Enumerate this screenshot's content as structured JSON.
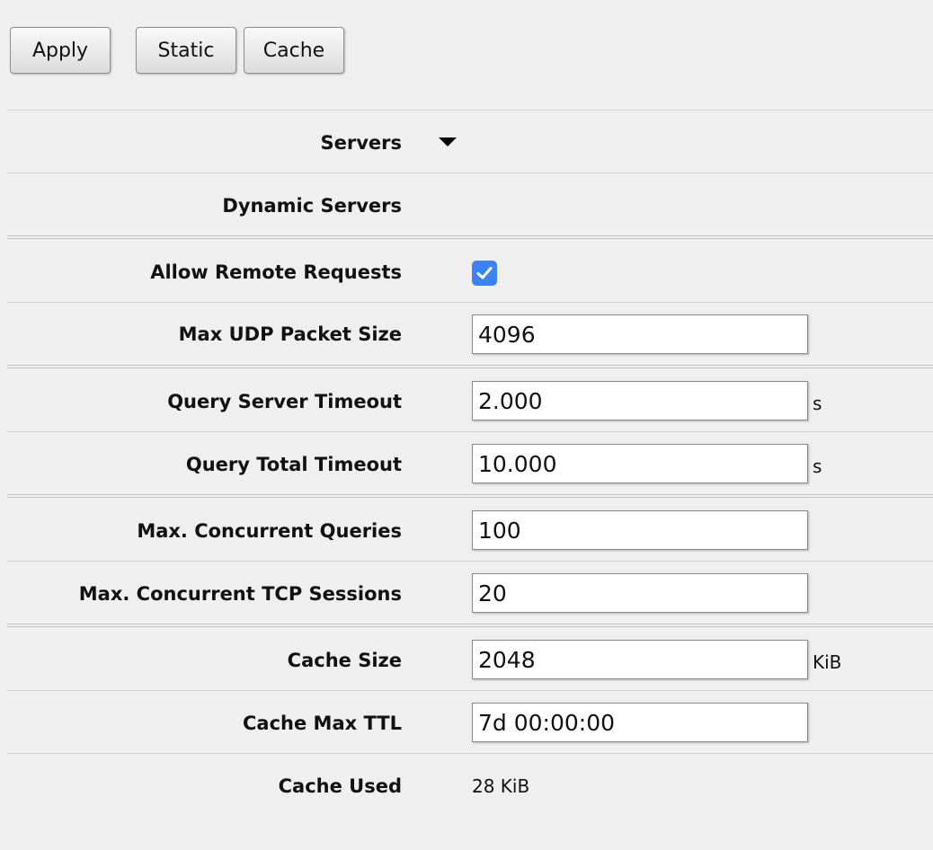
{
  "toolbar": {
    "apply_label": "Apply",
    "static_label": "Static",
    "cache_label": "Cache"
  },
  "form": {
    "servers_label": "Servers",
    "dynamic_servers_label": "Dynamic Servers",
    "allow_remote_requests_label": "Allow Remote Requests",
    "allow_remote_requests_checked": true,
    "max_udp_packet_size_label": "Max UDP Packet Size",
    "max_udp_packet_size_value": "4096",
    "query_server_timeout_label": "Query Server Timeout",
    "query_server_timeout_value": "2.000",
    "query_server_timeout_unit": "s",
    "query_total_timeout_label": "Query Total Timeout",
    "query_total_timeout_value": "10.000",
    "query_total_timeout_unit": "s",
    "max_concurrent_queries_label": "Max. Concurrent Queries",
    "max_concurrent_queries_value": "100",
    "max_concurrent_tcp_sessions_label": "Max. Concurrent TCP Sessions",
    "max_concurrent_tcp_sessions_value": "20",
    "cache_size_label": "Cache Size",
    "cache_size_value": "2048",
    "cache_size_unit": "KiB",
    "cache_max_ttl_label": "Cache Max TTL",
    "cache_max_ttl_value": "7d 00:00:00",
    "cache_used_label": "Cache Used",
    "cache_used_value": "28 KiB"
  },
  "colors": {
    "background": "#efefef",
    "checkbox_accent": "#3b82f6"
  },
  "icons": {
    "servers_dropdown": "caret-down-icon",
    "checkbox_mark": "check-icon"
  }
}
